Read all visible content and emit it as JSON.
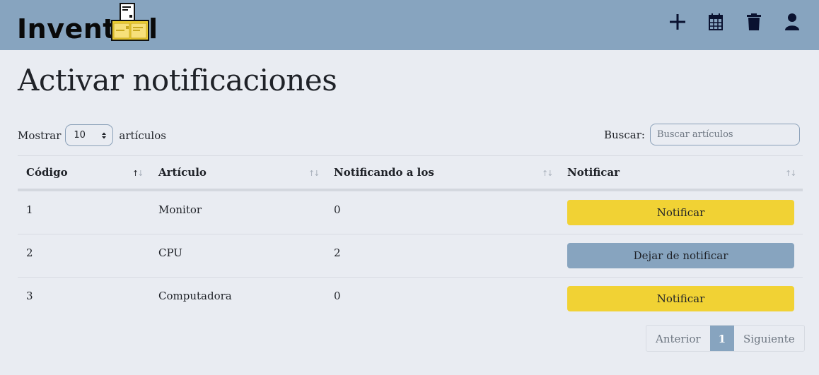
{
  "brand": {
    "text_start": "Invent",
    "text_end": "l",
    "logo": "box-with-documents-logo"
  },
  "nav": {
    "icons": [
      "plus-icon",
      "calendar-icon",
      "trash-icon",
      "user-icon"
    ]
  },
  "page": {
    "title": "Activar notificaciones"
  },
  "length": {
    "label_before": "Mostrar",
    "value": "10",
    "label_after": "artículos"
  },
  "search": {
    "label": "Buscar:",
    "placeholder": "Buscar artículos"
  },
  "table": {
    "headers": [
      "Código",
      "Artículo",
      "Notificando a los",
      "Notificar"
    ],
    "rows": [
      {
        "codigo": "1",
        "articulo": "Monitor",
        "notificando": "0",
        "action": "Notificar",
        "state": "notify"
      },
      {
        "codigo": "2",
        "articulo": "CPU",
        "notificando": "2",
        "action": "Dejar de notificar",
        "state": "stop"
      },
      {
        "codigo": "3",
        "articulo": "Computadora",
        "notificando": "0",
        "action": "Notificar",
        "state": "notify"
      }
    ]
  },
  "pagination": {
    "prev": "Anterior",
    "current": "1",
    "next": "Siguiente"
  },
  "colors": {
    "navbar": "#87a4bf",
    "notify": "#f1d234",
    "stop": "#87a4bf",
    "background": "#e9ecf2"
  }
}
